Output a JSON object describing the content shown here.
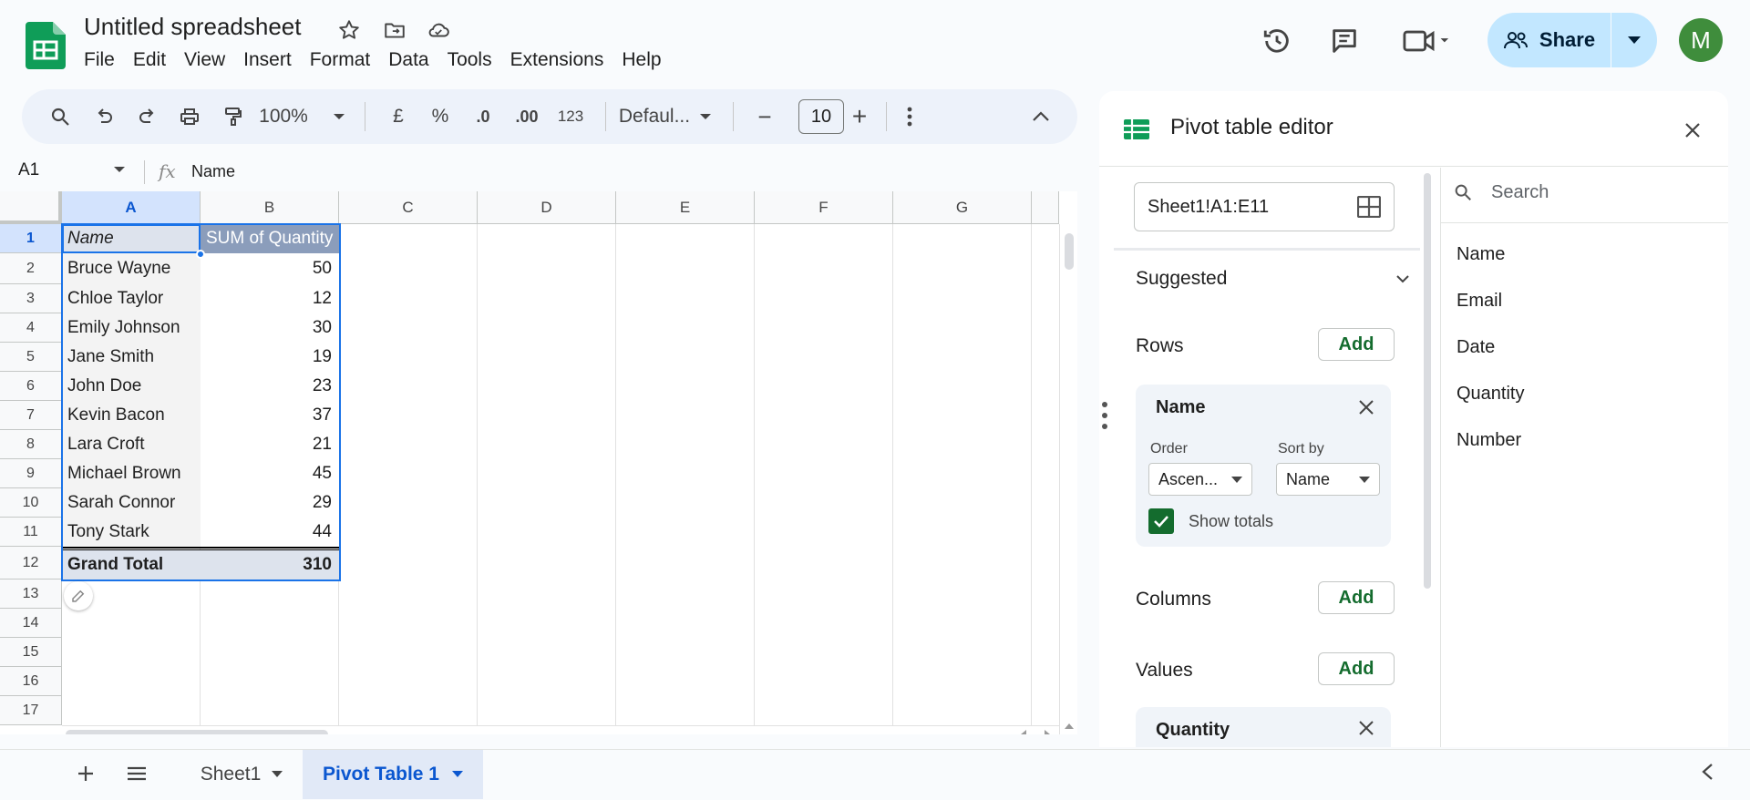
{
  "app": {
    "doc_title": "Untitled spreadsheet",
    "menu": [
      "File",
      "Edit",
      "View",
      "Insert",
      "Format",
      "Data",
      "Tools",
      "Extensions",
      "Help"
    ],
    "share_label": "Share",
    "avatar_letter": "M"
  },
  "toolbar": {
    "zoom": "100%",
    "currency": "£",
    "percent": "%",
    "dec_decrease": ".0",
    "dec_increase": ".00",
    "number_format": "123",
    "font": "Defaul...",
    "font_size": "10",
    "minus": "−",
    "plus": "+"
  },
  "formula_bar": {
    "cell_ref": "A1",
    "fx": "fx",
    "value": "Name"
  },
  "grid": {
    "columns": [
      "A",
      "B",
      "C",
      "D",
      "E",
      "F",
      "G"
    ],
    "rows": [
      "1",
      "2",
      "3",
      "4",
      "5",
      "6",
      "7",
      "8",
      "9",
      "10",
      "11",
      "12",
      "13",
      "14",
      "15",
      "16",
      "17"
    ],
    "header": {
      "name": "Name",
      "qty": "SUM of Quantity"
    },
    "data": [
      {
        "name": "Bruce Wayne",
        "qty": "50"
      },
      {
        "name": "Chloe Taylor",
        "qty": "12"
      },
      {
        "name": "Emily Johnson",
        "qty": "30"
      },
      {
        "name": "Jane Smith",
        "qty": "19"
      },
      {
        "name": "John Doe",
        "qty": "23"
      },
      {
        "name": "Kevin Bacon",
        "qty": "37"
      },
      {
        "name": "Lara Croft",
        "qty": "21"
      },
      {
        "name": "Michael Brown",
        "qty": "45"
      },
      {
        "name": "Sarah Connor",
        "qty": "29"
      },
      {
        "name": "Tony Stark",
        "qty": "44"
      }
    ],
    "total": {
      "name": "Grand Total",
      "qty": "310"
    }
  },
  "sheets": {
    "tabs": [
      "Sheet1",
      "Pivot Table 1"
    ],
    "active": "Pivot Table 1"
  },
  "pivot_editor": {
    "title": "Pivot table editor",
    "range": "Sheet1!A1:E11",
    "suggested": "Suggested",
    "rows_label": "Rows",
    "columns_label": "Columns",
    "values_label": "Values",
    "add": "Add",
    "row_field": {
      "name": "Name",
      "order_label": "Order",
      "order_value": "Ascen...",
      "sortby_label": "Sort by",
      "sortby_value": "Name",
      "show_totals": "Show totals"
    },
    "value_field": {
      "name": "Quantity"
    },
    "search_placeholder": "Search",
    "fields": [
      "Name",
      "Email",
      "Date",
      "Quantity",
      "Number"
    ]
  },
  "colors": {
    "accent_green": "#146c2e",
    "selection_blue": "#1a73e8",
    "pivot_header": "#8b9dbb",
    "share_bg": "#c2e7ff"
  }
}
